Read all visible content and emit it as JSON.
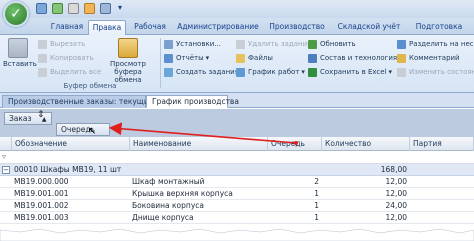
{
  "ribbon": {
    "tabs": [
      "Главная",
      "Правка",
      "Рабочая",
      "Администрирование",
      "Производство",
      "Складской учёт",
      "Подготовка"
    ],
    "active_tab": "Правка",
    "clipboard_group": {
      "paste": "Вставить",
      "cut": "Вырезать",
      "copy": "Копировать",
      "select_all": "Выделить все",
      "preview": "Просмотр буфера обмена",
      "caption": "Буфер обмена"
    },
    "tools": {
      "settings": "Установки...",
      "reports": "Отчёты",
      "create_task": "Создать задания",
      "delete_task": "Удалить задания",
      "files": "Файлы",
      "work_schedule": "График работ",
      "refresh": "Обновить",
      "composition": "Состав и технология",
      "save_excel": "Сохранить в Excel",
      "split": "Разделить на несколько",
      "comments": "Комментарий",
      "change_status": "Изменить состояние"
    }
  },
  "doc_tabs": [
    "Производственные заказы: текущие",
    "График производства"
  ],
  "group_panel": {
    "chips": [
      "Заказ",
      "Очередь"
    ]
  },
  "grid": {
    "columns": [
      "Обозначение",
      "Наименование",
      "Очередь",
      "Количество",
      "Партия"
    ],
    "group_row": {
      "label": "00010 Шкафы МВ19, 11 шт",
      "amount": "168,00"
    },
    "rows": [
      {
        "code": "МВ19.000.000",
        "name": "Шкаф монтажный",
        "queue": "2",
        "qty": "12,00"
      },
      {
        "code": "МВ19.001.001",
        "name": "Крышка верхняя корпуса",
        "queue": "1",
        "qty": "12,00"
      },
      {
        "code": "МВ19.001.002",
        "name": "Боковина корпуса",
        "queue": "1",
        "qty": "24,00"
      },
      {
        "code": "МВ19.001.003",
        "name": "Днище корпуса",
        "queue": "1",
        "qty": "12,00"
      }
    ]
  },
  "colors": {
    "accent": "#15428b",
    "arrow": "#e0201e",
    "ribbon_bg": "#d6e4f4",
    "group_panel_bg": "#bccbe0"
  }
}
